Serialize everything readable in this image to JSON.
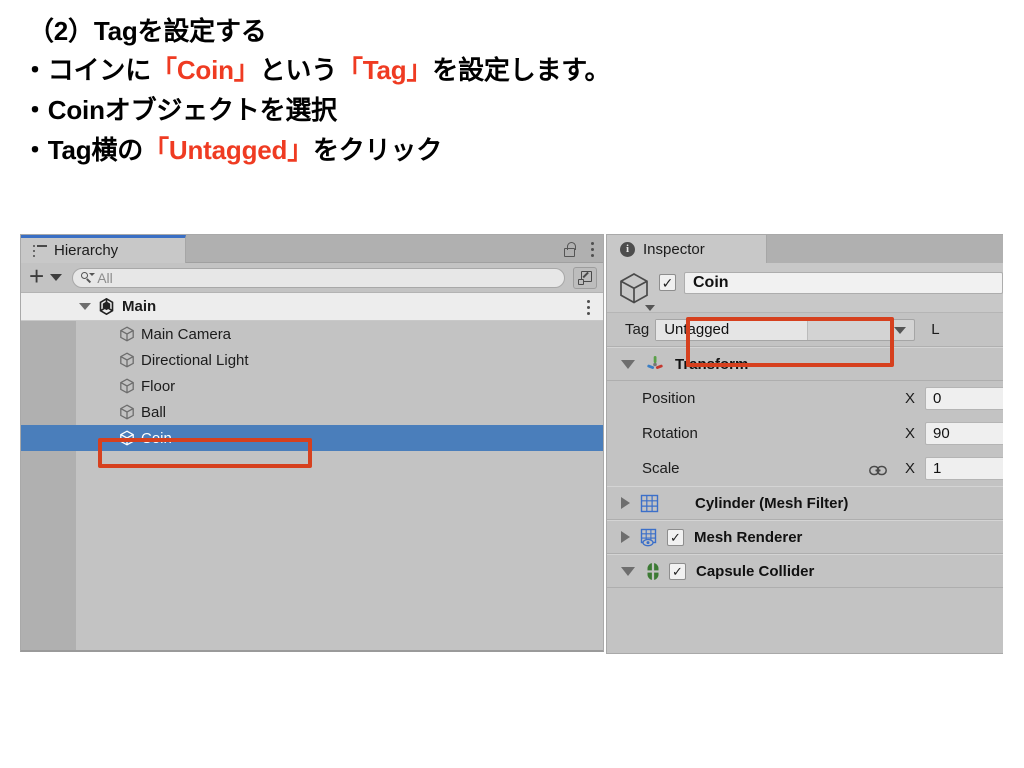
{
  "slide": {
    "line1": "（2）Tagを設定する",
    "line2_a": "・コインに",
    "line2_hl1": "「Coin」",
    "line2_b": "という",
    "line2_hl2": "「Tag」",
    "line2_c": "を設定します。",
    "line3": "・Coinオブジェクトを選択",
    "line4_a": "・Tag横の",
    "line4_hl": "「Untagged」",
    "line4_b": "をクリック",
    "highlight_color": "#ef3b22",
    "text_color": "#000000"
  },
  "hierarchy": {
    "tab_label": "Hierarchy",
    "tab_icon": "hierarchy-list-icon",
    "lock_icon": "unlocked-padlock-icon",
    "menu_icon": "kebab-menu-icon",
    "add_button_label": "+",
    "add_dropdown_icon": "chevron-down-icon",
    "search": {
      "icon": "search-icon",
      "value": "",
      "placeholder": "All"
    },
    "expand_button_icon": "expand-window-icon",
    "scene_row": {
      "label": "Main",
      "icon": "unity-scene-icon",
      "expanded": true,
      "menu_icon": "kebab-menu-icon"
    },
    "objects": [
      {
        "label": "Main Camera",
        "icon": "gameobject-cube-icon",
        "selected": false
      },
      {
        "label": "Directional Light",
        "icon": "gameobject-cube-icon",
        "selected": false
      },
      {
        "label": "Floor",
        "icon": "gameobject-cube-icon",
        "selected": false
      },
      {
        "label": "Ball",
        "icon": "gameobject-cube-icon",
        "selected": false
      },
      {
        "label": "Coin",
        "icon": "gameobject-cube-icon",
        "selected": true
      }
    ],
    "selection_color": "#4a7ebb",
    "annotation_color": "#d6401e"
  },
  "inspector": {
    "tab_label": "Inspector",
    "tab_icon": "info-circle-icon",
    "object": {
      "icon": "gameobject-cube-icon",
      "enabled": true,
      "name": "Coin"
    },
    "tag": {
      "label": "Tag",
      "value": "Untagged",
      "dropdown_icon": "chevron-down-icon"
    },
    "layer": {
      "label": "L"
    },
    "transform": {
      "title": "Transform",
      "icon": "transform-gizmo-icon",
      "expanded": true,
      "rows": [
        {
          "label": "Position",
          "axis": "X",
          "value": "0",
          "link": false
        },
        {
          "label": "Rotation",
          "axis": "X",
          "value": "90",
          "link": false
        },
        {
          "label": "Scale",
          "axis": "X",
          "value": "1",
          "link": true
        }
      ],
      "link_icon": "chain-link-icon"
    },
    "components": [
      {
        "title": "Cylinder (Mesh Filter)",
        "icon": "mesh-filter-icon",
        "expanded": false,
        "has_checkbox": false,
        "checked": false
      },
      {
        "title": "Mesh Renderer",
        "icon": "mesh-renderer-icon",
        "expanded": false,
        "has_checkbox": true,
        "checked": true
      },
      {
        "title": "Capsule Collider",
        "icon": "capsule-collider-icon",
        "expanded": true,
        "has_checkbox": true,
        "checked": true
      }
    ]
  }
}
